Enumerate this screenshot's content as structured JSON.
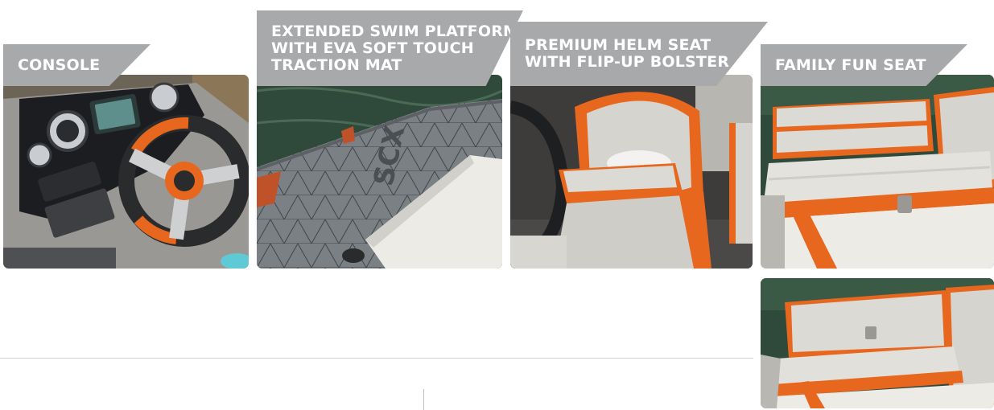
{
  "captions": {
    "console": [
      "CONSOLE"
    ],
    "swim_platform": [
      "EXTENDED SWIM PLATFORM",
      "WITH EVA SOFT TOUCH",
      "TRACTION MAT"
    ],
    "helm_seat": [
      "PREMIUM HELM SEAT",
      "WITH FLIP-UP BOLSTER"
    ],
    "family_seat": [
      "FAMILY FUN SEAT"
    ]
  },
  "photos": {
    "console": "boat-console-photo",
    "swim_platform": "swim-platform-photo",
    "helm_seat": "helm-seat-photo",
    "family_seat_top": "family-fun-seat-photo",
    "family_seat_bottom": "family-fun-seat-alt-photo"
  },
  "platform_logo": "SCX",
  "colors": {
    "caption_tab": "#a7a9ab",
    "caption_text": "#ffffff",
    "accent_orange": "#e8671e",
    "water": "#2f4a3a",
    "vinyl_light": "#d9d7d2",
    "mat_gray": "#7b8084",
    "divider": "#cfd0d2"
  }
}
